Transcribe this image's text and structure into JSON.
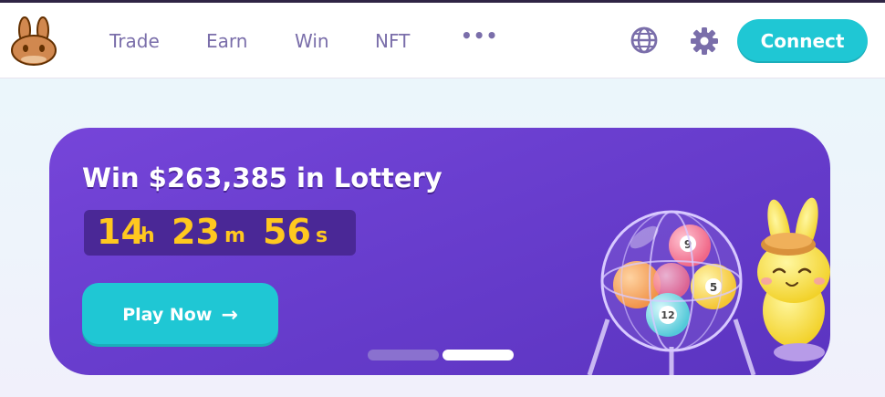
{
  "nav": {
    "menu": [
      "Trade",
      "Earn",
      "Win",
      "NFT",
      "•••"
    ],
    "connect_label": "Connect"
  },
  "banner": {
    "title": "Win $263,385 in Lottery",
    "countdown": {
      "hours": "14",
      "hours_unit": "h",
      "minutes": "23",
      "minutes_unit": "m",
      "seconds": "56",
      "seconds_unit": "s"
    },
    "play_label": "Play Now",
    "play_arrow": "→",
    "carousel": {
      "count": 2,
      "active_index": 1
    }
  },
  "balls": [
    "9",
    "5",
    "12"
  ],
  "icons": {
    "logo": "pancake-bunny-logo",
    "language": "globe-icon",
    "settings": "gear-icon",
    "play": "arrow-right-icon"
  },
  "colors": {
    "accent": "#1fc7d4",
    "nav_text": "#7a6eaa",
    "banner_start": "#7645d9",
    "banner_end": "#5b34c0",
    "timer_text": "#ffc81f"
  }
}
